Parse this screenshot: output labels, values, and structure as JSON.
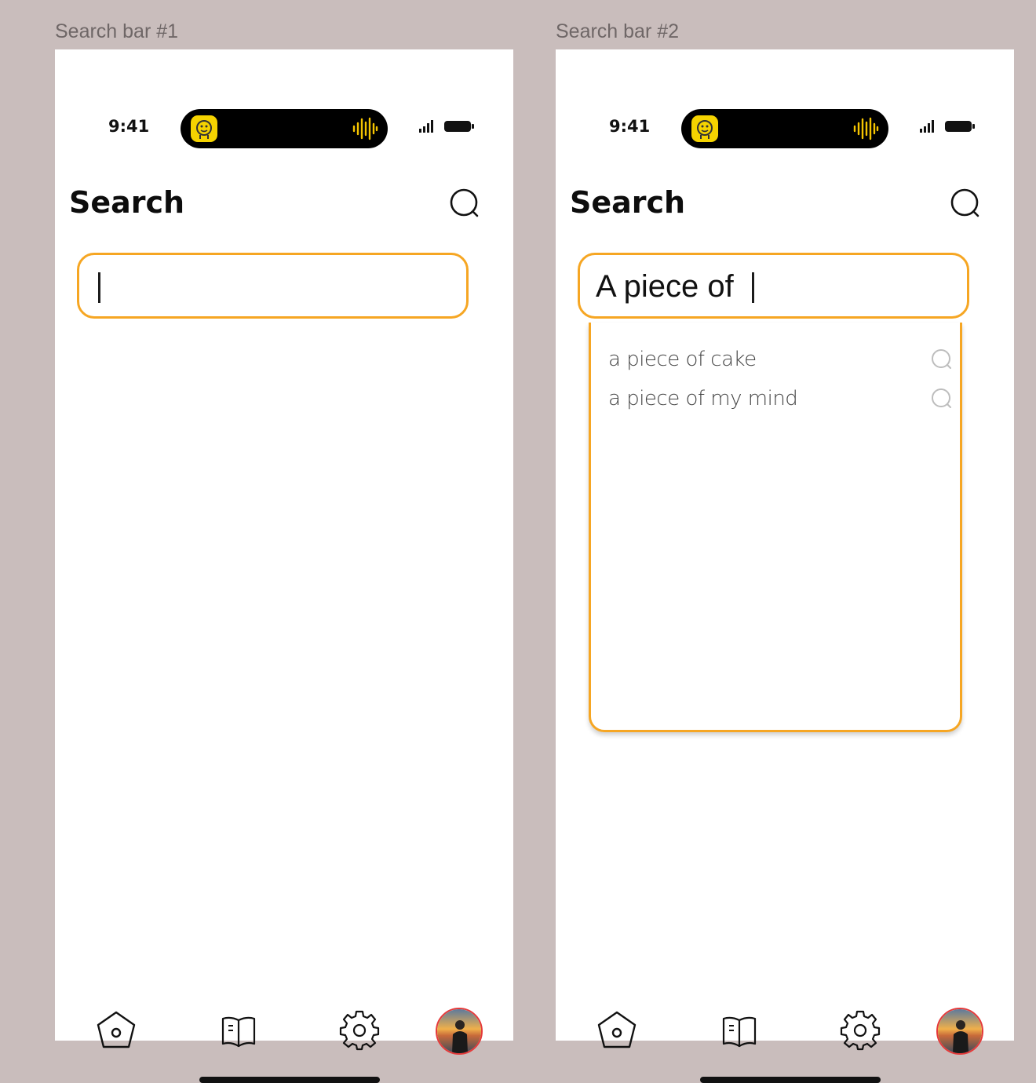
{
  "screens": [
    {
      "frame_label": "Search bar #1",
      "status_bar": {
        "time": "9:41"
      },
      "header": {
        "title": "Search"
      },
      "search_field": {
        "value": ""
      },
      "suggestions": [],
      "tab_bar": {
        "items": [
          "home-icon",
          "book-icon",
          "settings-icon",
          "profile-avatar"
        ]
      }
    },
    {
      "frame_label": "Search bar #2",
      "status_bar": {
        "time": "9:41"
      },
      "header": {
        "title": "Search"
      },
      "search_field": {
        "value": "A piece of"
      },
      "suggestions": [
        {
          "label": "a piece of cake",
          "icon": "search-icon"
        },
        {
          "label": "a piece of my mind",
          "icon": "search-icon"
        }
      ],
      "tab_bar": {
        "items": [
          "home-icon",
          "book-icon",
          "settings-icon",
          "profile-avatar"
        ]
      }
    }
  ],
  "colors": {
    "canvas": "#c9bdbc",
    "accent": "#f6a623",
    "island_app": "#f5d300",
    "avatar_ring": "#e53a3a"
  }
}
